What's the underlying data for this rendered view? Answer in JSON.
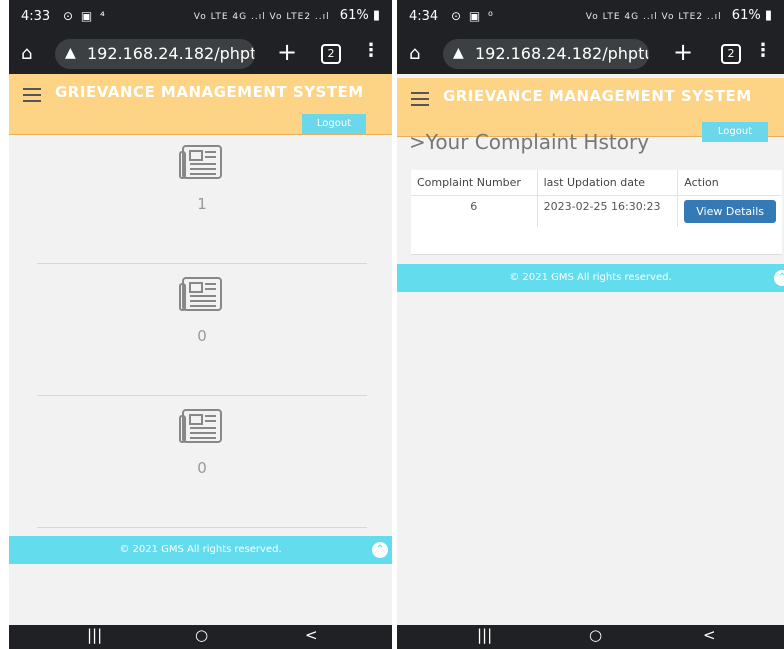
{
  "left": {
    "status": {
      "time": "4:33",
      "icons": "⊙ ▣ ⁴",
      "signal": "Vo LTE 4G ..ıl Vo LTE2 ..ıl",
      "battery": "61%"
    },
    "browser": {
      "url": "192.168.24.182/phptu",
      "tabs": "2"
    },
    "header": {
      "title": "GRIEVANCE MANAGEMENT SYSTEM",
      "logout": "Logout"
    },
    "stats": [
      {
        "value": "1"
      },
      {
        "value": "0"
      },
      {
        "value": "0"
      }
    ],
    "footer": "© 2021 GMS All rights reserved.",
    "nav": {
      "recent": "|||",
      "home": "○",
      "back": "<"
    }
  },
  "right": {
    "status": {
      "time": "4:34",
      "icons": "⊙ ▣ ⁰",
      "signal": "Vo LTE 4G ..ıl Vo LTE2 ..ıl",
      "battery": "61%"
    },
    "browser": {
      "url": "192.168.24.182/phptu",
      "tabs": "2"
    },
    "header": {
      "title": "GRIEVANCE MANAGEMENT SYSTEM",
      "logout": "Logout"
    },
    "heading": ">Your Complaint Hstory",
    "table": {
      "headers": [
        "Complaint Number",
        "last Updation date",
        "Action"
      ],
      "rows": [
        {
          "number": "6",
          "date": "2023-02-25 16:30:23",
          "action": "View Details"
        }
      ]
    },
    "footer": "© 2021 GMS All rights reserved.",
    "nav": {
      "recent": "|||",
      "home": "○",
      "back": "<"
    }
  }
}
